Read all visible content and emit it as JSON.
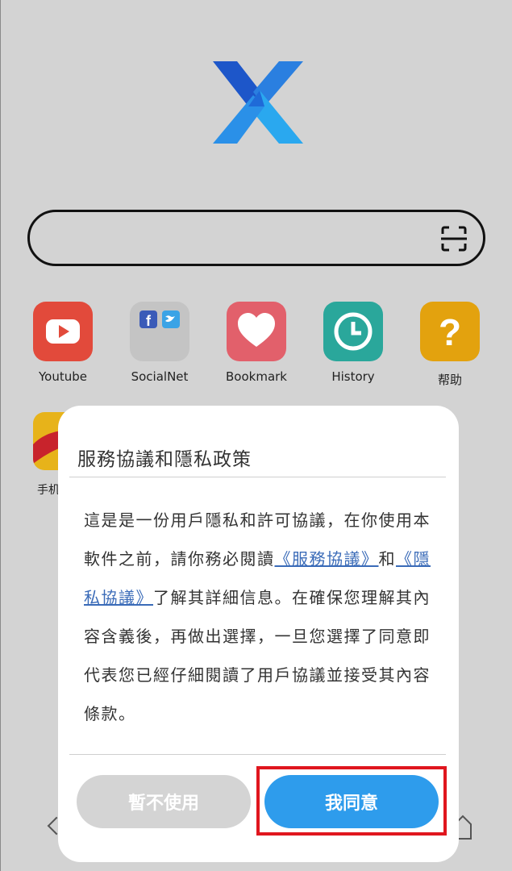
{
  "shortcuts": [
    {
      "label": "Youtube",
      "icon": "youtube-icon",
      "color": "#e24a3b"
    },
    {
      "label": "SocialNet",
      "icon": "social-network-icon",
      "color": "#c4c4c4"
    },
    {
      "label": "Bookmark",
      "icon": "heart-icon",
      "color": "#e2606b"
    },
    {
      "label": "History",
      "icon": "clock-icon",
      "color": "#2aa79b"
    },
    {
      "label": "帮助",
      "icon": "question-icon",
      "color": "#e3a20e"
    }
  ],
  "pinned_label": "手机",
  "dialog": {
    "title": "服務協議和隱私政策",
    "body_part1": "這是是一份用戶隱私和許可協議，在你使用本軟件之前，請你務必閱讀",
    "link_service": "《服務協議》",
    "body_and": "和",
    "link_privacy": "《隱私協議》",
    "body_part2": "了解其詳細信息。在確保您理解其內容含義後，再做出選擇，一旦您選擇了同意即代表您已經仔細閱讀了用戶協議並接受其內容條款。",
    "decline_label": "暫不使用",
    "agree_label": "我同意"
  },
  "colors": {
    "accent": "#2e9cec",
    "highlight": "#e0161e",
    "link": "#3a6bb8"
  }
}
